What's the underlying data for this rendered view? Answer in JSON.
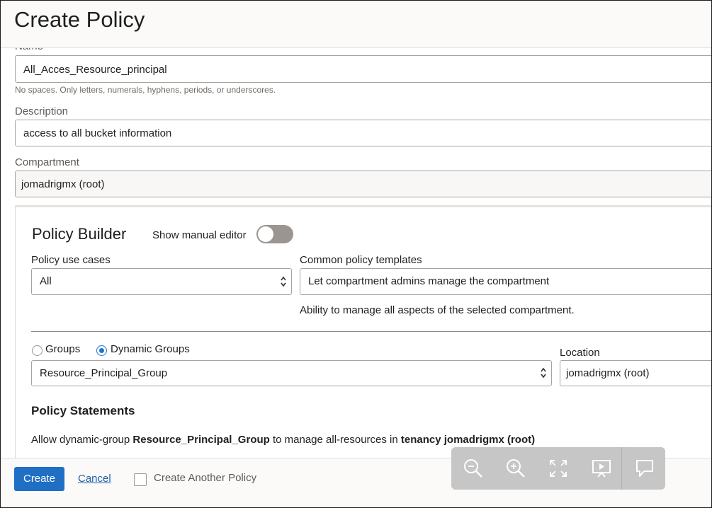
{
  "header": {
    "title": "Create Policy"
  },
  "form": {
    "name": {
      "label": "Name",
      "value": "All_Acces_Resource_principal",
      "hint": "No spaces. Only letters, numerals, hyphens, periods, or underscores."
    },
    "description": {
      "label": "Description",
      "value": "access to all bucket information"
    },
    "compartment": {
      "label": "Compartment",
      "value": "jomadrigmx (root)"
    }
  },
  "builder": {
    "title": "Policy Builder",
    "manual_editor_label": "Show manual editor",
    "manual_editor_on": false,
    "use_cases_label": "Policy use cases",
    "use_cases_value": "All",
    "templates_label": "Common policy templates",
    "templates_value": "Let compartment admins manage the compartment",
    "templates_desc": "Ability to manage all aspects of the selected compartment.",
    "groups_label": "Groups",
    "dynamic_groups_label": "Dynamic Groups",
    "selected_group_type": "Dynamic Groups",
    "group_value": "Resource_Principal_Group",
    "location_label": "Location",
    "location_value": "jomadrigmx (root)",
    "statements_title": "Policy Statements",
    "statement": {
      "prefix": "Allow dynamic-group ",
      "group": "Resource_Principal_Group",
      "middle": " to manage all-resources in ",
      "scope": "tenancy jomadrigmx (root)"
    }
  },
  "footer": {
    "create_label": "Create",
    "cancel_label": "Cancel",
    "another_label": "Create Another Policy",
    "another_checked": false
  },
  "toolbar": {
    "icons": [
      "zoom-out-icon",
      "zoom-in-icon",
      "fullscreen-icon",
      "presentation-icon",
      "comment-icon"
    ]
  },
  "colors": {
    "primary": "#1f6fc5",
    "link": "#1f5ea8",
    "radio_selected": "#1f74d0",
    "toggle_off": "#9a9590"
  }
}
